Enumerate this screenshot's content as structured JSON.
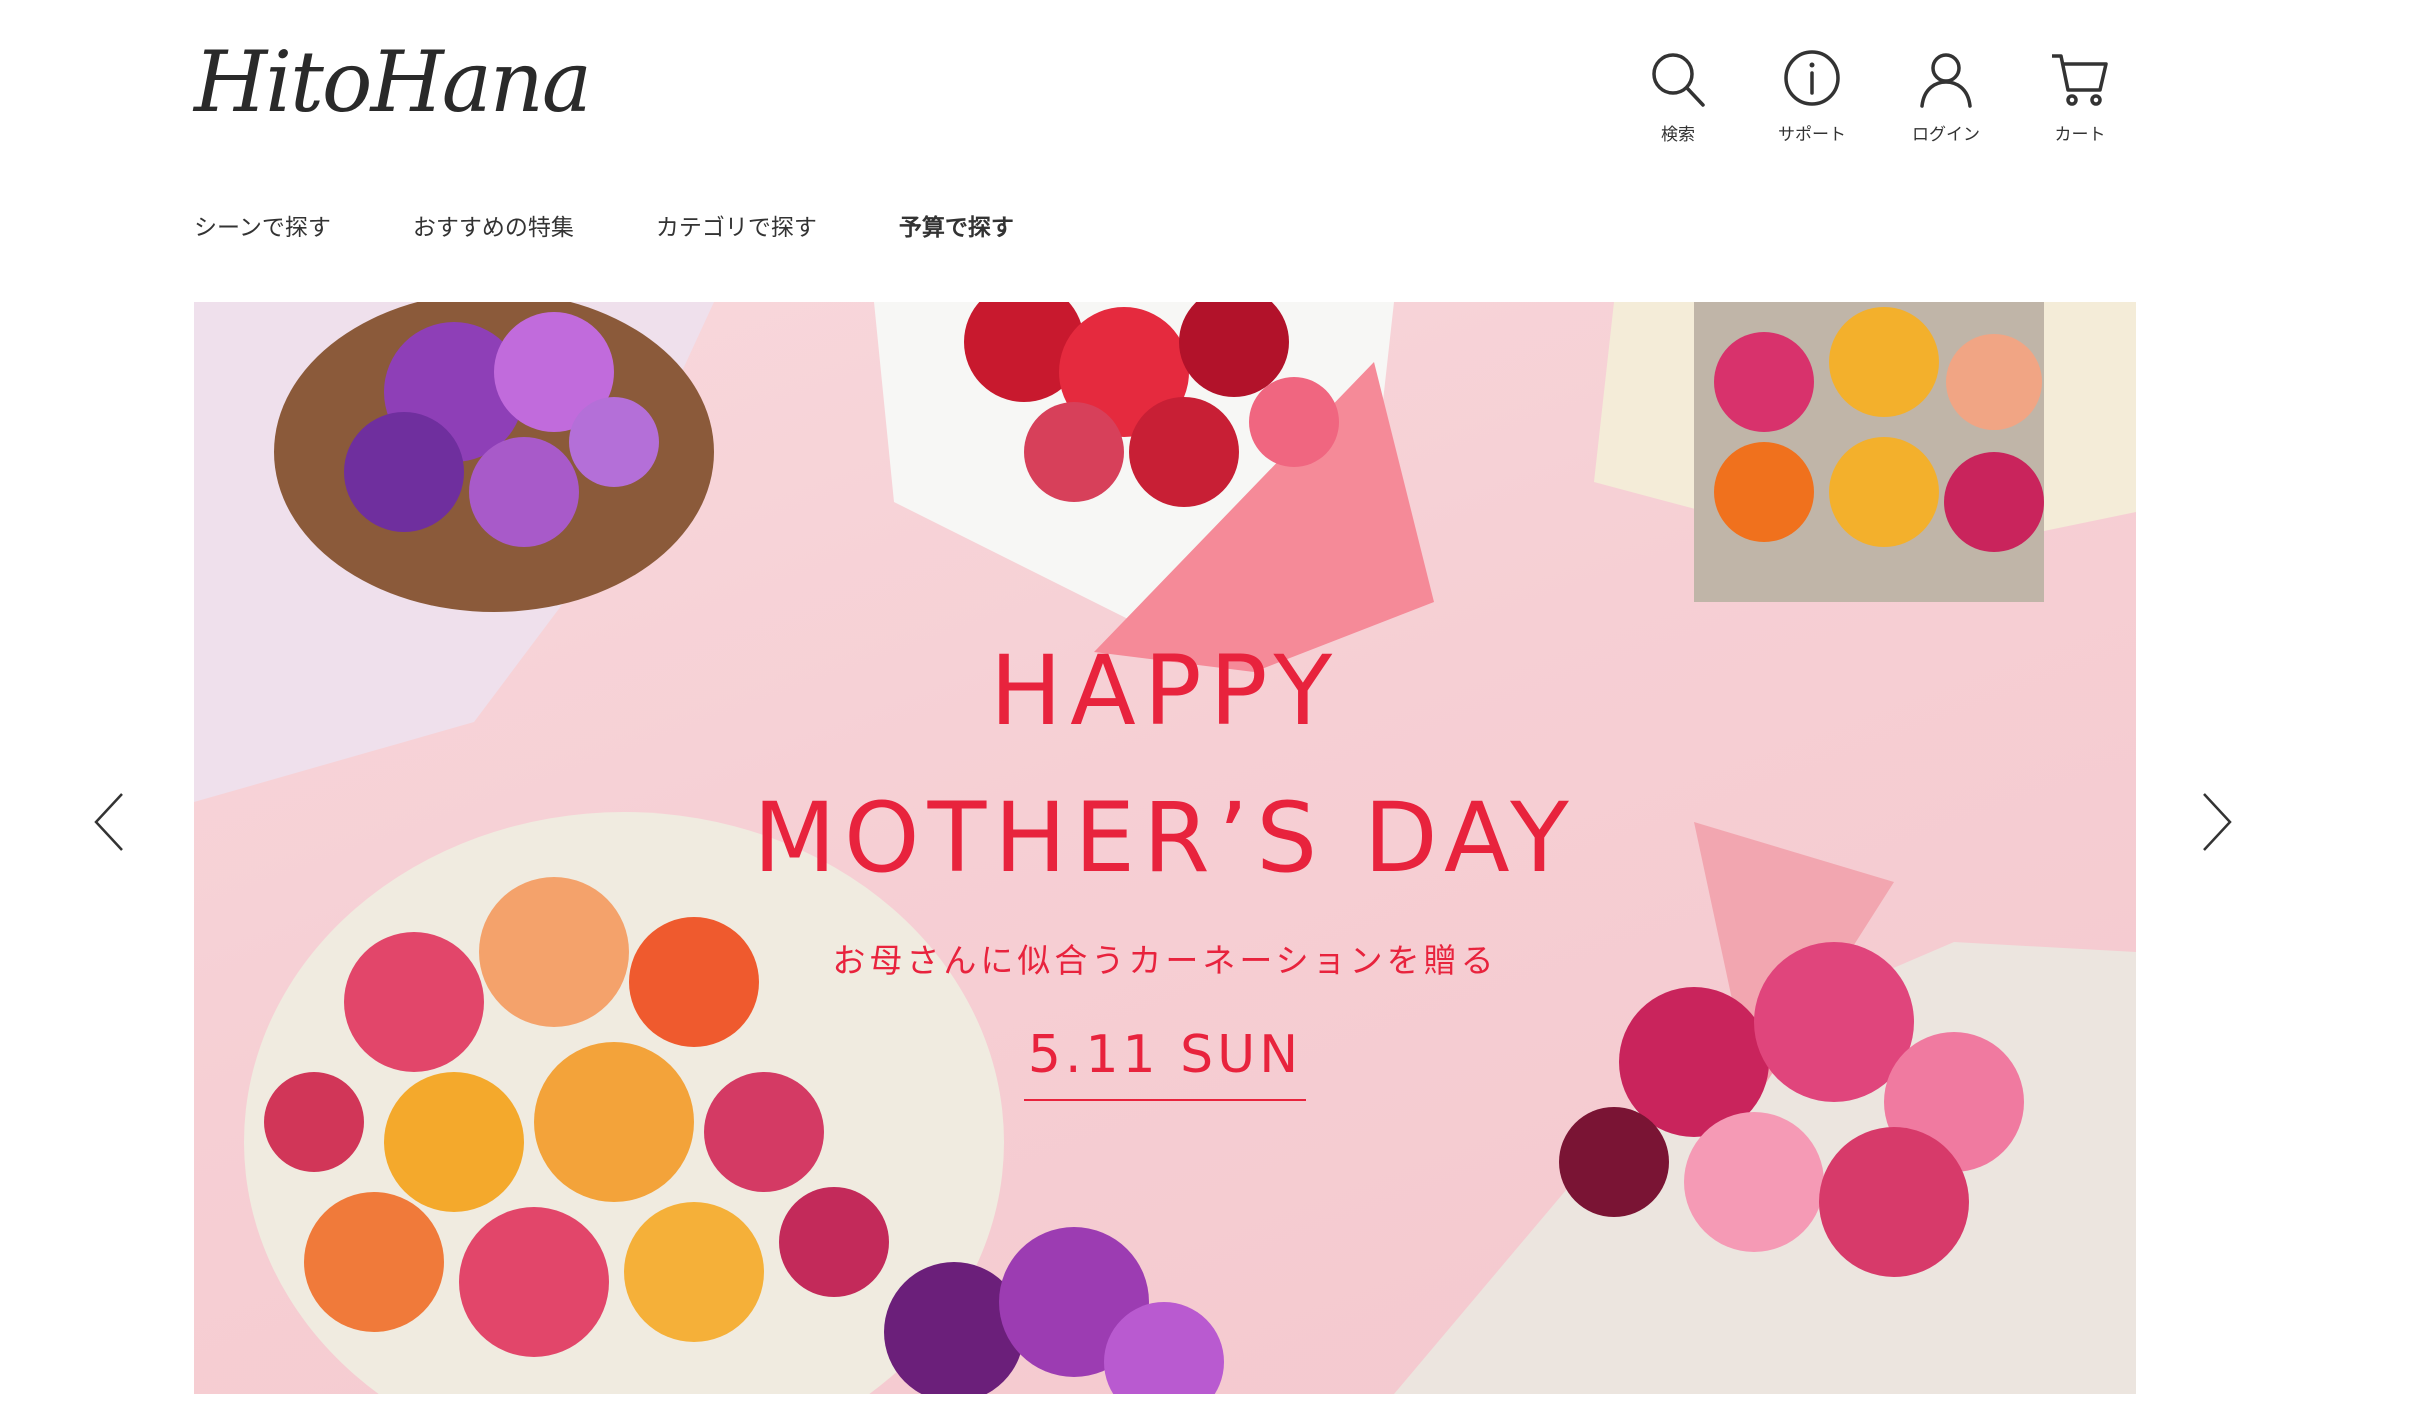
{
  "header": {
    "logo": "HitoHana",
    "icons": [
      {
        "name": "search-icon",
        "label": "検索"
      },
      {
        "name": "info-icon",
        "label": "サポート"
      },
      {
        "name": "user-icon",
        "label": "ログイン"
      },
      {
        "name": "cart-icon",
        "label": "カート"
      }
    ]
  },
  "nav": {
    "items": [
      "シーンで探す",
      "おすすめの特集",
      "カテゴリで探す",
      "予算で探す"
    ]
  },
  "hero": {
    "line1": "HAPPY",
    "line2": "MOTHER’S DAY",
    "subtitle": "お母さんに似合うカーネーションを贈る",
    "date": "5.11 SUN",
    "accent_color": "#e8233d",
    "background_color": "#f7d3d8"
  },
  "carousel": {
    "prev_icon": "chevron-left-icon",
    "next_icon": "chevron-right-icon"
  }
}
